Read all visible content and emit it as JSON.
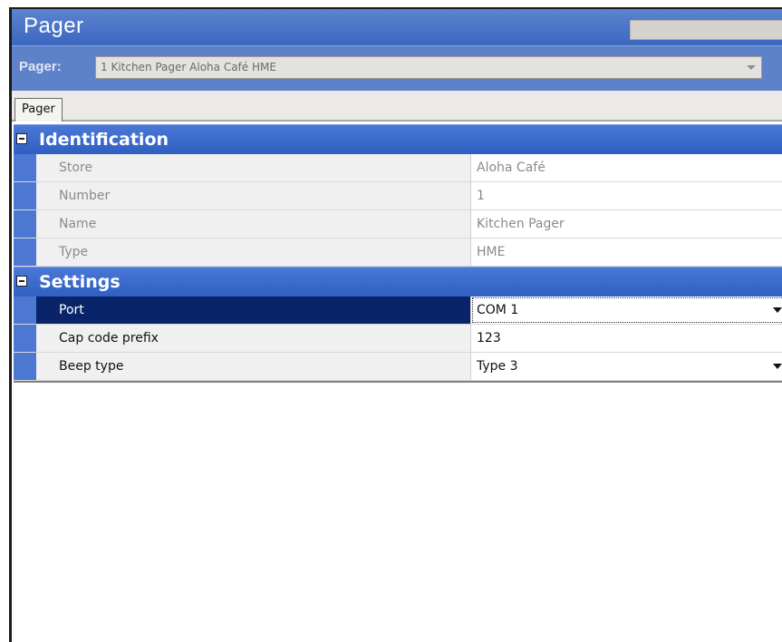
{
  "window": {
    "title": "Pager"
  },
  "selector": {
    "label": "Pager:",
    "value": "1 Kitchen Pager Aloha Café HME"
  },
  "tabs": [
    {
      "label": "Pager"
    }
  ],
  "sections": {
    "identification": {
      "title": "Identification",
      "rows": [
        {
          "label": "Store",
          "value": "Aloha Café"
        },
        {
          "label": "Number",
          "value": "1"
        },
        {
          "label": "Name",
          "value": "Kitchen Pager"
        },
        {
          "label": "Type",
          "value": "HME"
        }
      ]
    },
    "settings": {
      "title": "Settings",
      "rows": [
        {
          "label": "Port",
          "value": "COM 1"
        },
        {
          "label": "Cap code prefix",
          "value": "123"
        },
        {
          "label": "Beep type",
          "value": "Type 3"
        }
      ]
    }
  },
  "colors": {
    "header_blue": "#3c67c0",
    "section_blue": "#2f5fc0",
    "selected_row": "#0a246a"
  },
  "icons": {
    "collapse": "minus-box-icon",
    "dropdown": "chevron-down-icon"
  }
}
